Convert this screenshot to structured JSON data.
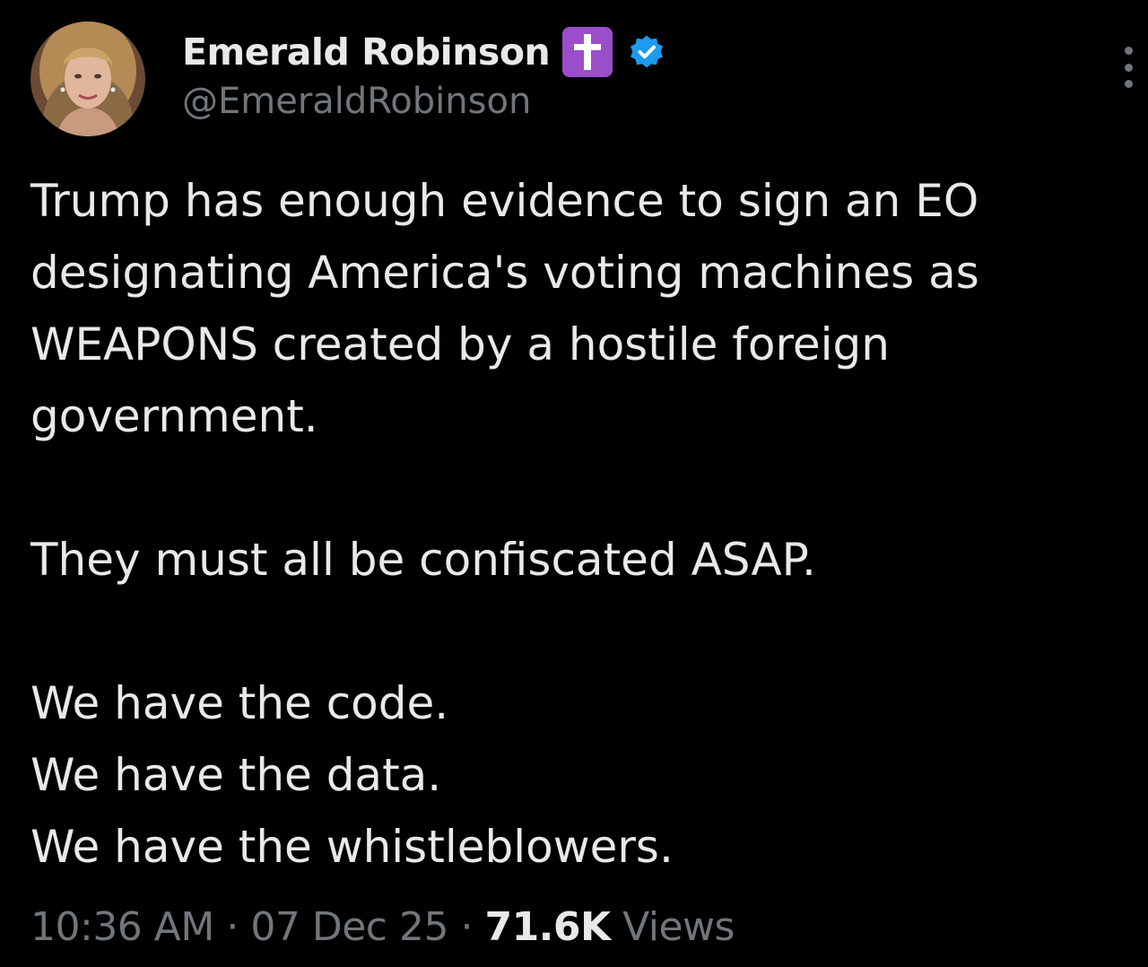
{
  "author": {
    "display_name": "Emerald Robinson",
    "badge_emoji": "✝️",
    "handle": "@EmeraldRobinson"
  },
  "tweet": {
    "paragraph_1": "Trump has enough evidence to sign an EO designating America's voting machines as WEAPONS created by a hostile foreign government.",
    "paragraph_2": "They must all be confiscated ASAP.",
    "line_3": "We have the code.",
    "line_4": "We have the data.",
    "line_5": "We have the whistleblowers."
  },
  "meta": {
    "time": "10:36 AM",
    "separator": "·",
    "date": "07 Dec 25",
    "views_count": "71.6K",
    "views_label": "Views"
  },
  "colors": {
    "background": "#000000",
    "text_primary": "#e7e9ea",
    "text_secondary": "#71767b",
    "verified_blue": "#1d9bf0",
    "cross_badge_purple": "#9b4dca"
  },
  "icons": {
    "verified": "verified-badge-icon",
    "cross": "latin-cross-emoji-icon",
    "more": "more-options-icon"
  }
}
